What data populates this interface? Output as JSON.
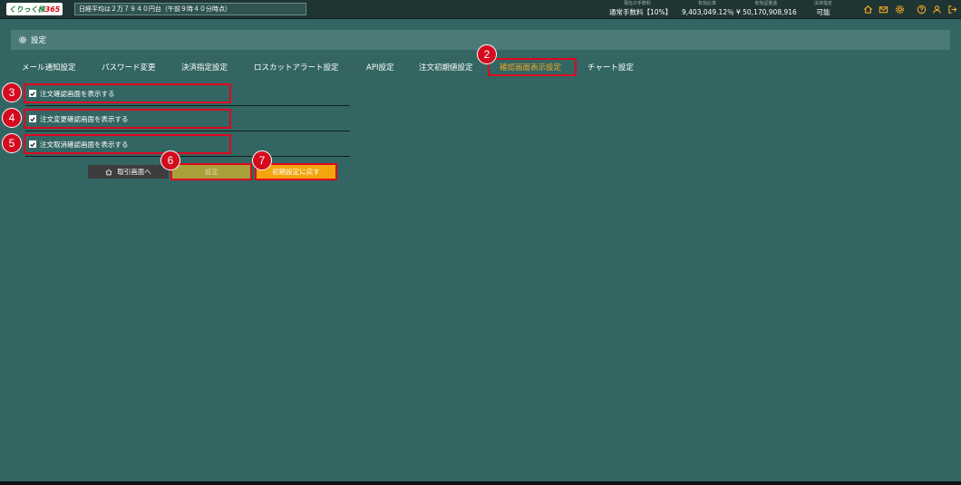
{
  "topbar": {
    "logo_text": "くりっく株",
    "logo_num": "365",
    "ticker": "日経平均は２万７９４０円台（午前９時４０分時点）",
    "stats": [
      {
        "label": "現在の手数料",
        "value": "通常手数料【10%】"
      },
      {
        "label": "有効比率",
        "value": "9,403,049.12％"
      },
      {
        "label": "有効証拠金",
        "value": "¥ 50,170,908,916"
      },
      {
        "label": "決済指定",
        "value": "可能"
      }
    ],
    "icons": [
      "home-icon",
      "mail-icon",
      "gear-icon",
      "help-icon",
      "user-icon",
      "logout-icon"
    ]
  },
  "page": {
    "title": "設定"
  },
  "tabs": [
    {
      "label": "メール通知設定"
    },
    {
      "label": "パスワード変更"
    },
    {
      "label": "決済指定設定"
    },
    {
      "label": "ロスカットアラート設定"
    },
    {
      "label": "API設定"
    },
    {
      "label": "注文初期値設定"
    },
    {
      "label": "確認画面表示設定",
      "active": true
    },
    {
      "label": "チャート設定"
    }
  ],
  "options": [
    {
      "label": "注文確認画面を表示する",
      "checked": true
    },
    {
      "label": "注文変更確認画面を表示する",
      "checked": true
    },
    {
      "label": "注文取消確認画面を表示する",
      "checked": true
    }
  ],
  "buttons": {
    "home": "取引画面へ",
    "set": "設定",
    "reset": "初期設定に戻す"
  },
  "badges": [
    "2",
    "3",
    "4",
    "5",
    "6",
    "7"
  ],
  "colors": {
    "background": "#336663",
    "active_tab": "#f5a623",
    "highlight": "#e0061f",
    "reset_button": "#f2a50d",
    "set_button": "#a9a03a"
  }
}
